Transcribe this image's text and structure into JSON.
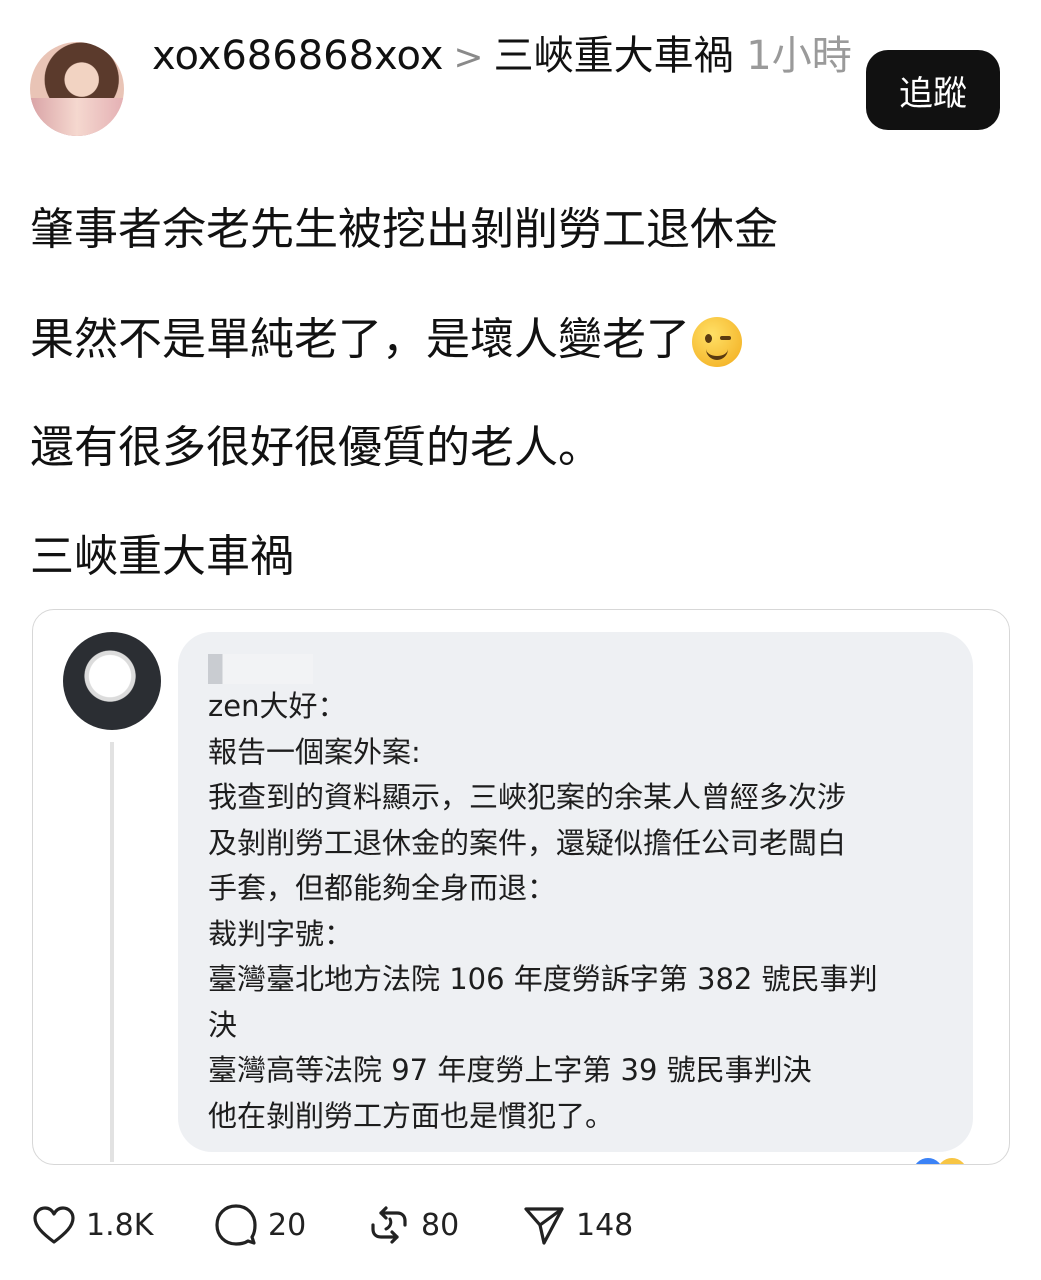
{
  "header": {
    "username": "xox686868xox",
    "separator": ">",
    "topic": "三峽重大車禍",
    "time": "1小時",
    "follow_label": "追蹤"
  },
  "post": {
    "line1": "肇事者余老先生被挖出剝削勞工退休金",
    "line2": "果然不是單純老了，是壞人變老了",
    "line2_emoji": "winking-face",
    "line3": "還有很多很好很優質的老人。",
    "line4": "三峽重大車禍"
  },
  "quoted_message": {
    "lines": [
      "zen大好：",
      "報告一個案外案:",
      "我查到的資料顯示，三峽犯案的余某人曾經多次涉",
      "及剝削勞工退休金的案件，還疑似擔任公司老闆白",
      "手套，但都能夠全身而退：",
      "裁判字號：",
      "臺灣臺北地方法院 106 年度勞訴字第 382 號民事判",
      "決",
      "臺灣高等法院 97 年度勞上字第 39 號民事判決",
      "他在剝削勞工方面也是慣犯了。"
    ]
  },
  "actions": {
    "likes": "1.8K",
    "comments": "20",
    "reposts": "80",
    "shares": "148"
  },
  "colors": {
    "text": "#111111",
    "muted": "#9a9a9a",
    "button_bg": "#111111",
    "bubble_bg": "#eef0f3"
  }
}
